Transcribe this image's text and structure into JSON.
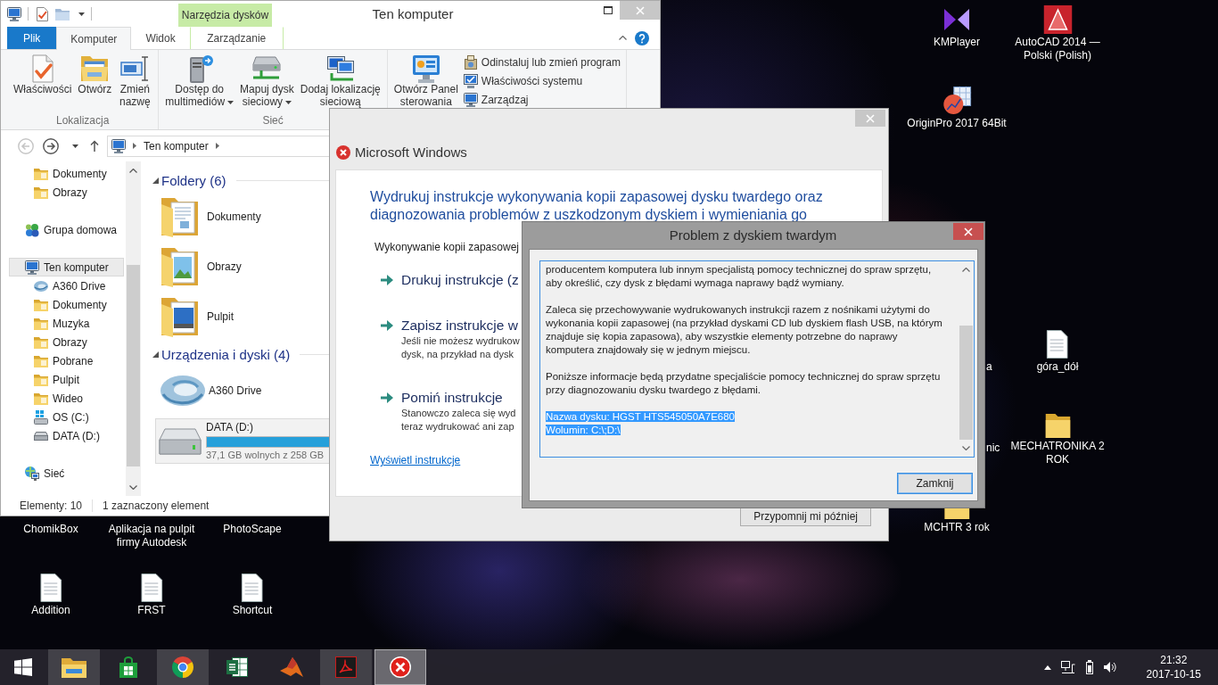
{
  "desktop": {
    "icons": [
      {
        "label": "KMPlayer"
      },
      {
        "label": "AutoCAD 2014 — Polski (Polish)"
      },
      {
        "label": "OriginPro 2017 64Bit"
      },
      {
        "label": "a"
      },
      {
        "label": "góra_dół"
      },
      {
        "label": "nic"
      },
      {
        "label": "MECHATRONIKA 2 ROK"
      },
      {
        "label": "ChomikBox"
      },
      {
        "label": "Aplikacja na pulpit firmy Autodesk"
      },
      {
        "label": "PhotoScape"
      },
      {
        "label": "MCHTR 3 rok"
      },
      {
        "label": "Addition"
      },
      {
        "label": "FRST"
      },
      {
        "label": "Shortcut"
      }
    ]
  },
  "explorer": {
    "title": "Ten komputer",
    "context_tab_group": "Narzędzia dysków",
    "tabs": [
      {
        "label": "Plik",
        "kind": "file",
        "selected": false
      },
      {
        "label": "Komputer",
        "kind": "tab",
        "selected": true
      },
      {
        "label": "Widok",
        "kind": "tab",
        "selected": false
      },
      {
        "label": "Zarządzanie",
        "kind": "contextual",
        "selected": false
      }
    ],
    "ribbon_groups": [
      {
        "label": "Lokalizacja",
        "buttons": [
          {
            "lines": [
              "Właściwości"
            ],
            "kind": "large",
            "dropdown": false
          },
          {
            "lines": [
              "Otwórz"
            ],
            "kind": "large",
            "dropdown": false
          },
          {
            "lines": [
              "Zmień",
              "nazwę"
            ],
            "kind": "large",
            "dropdown": false
          }
        ]
      },
      {
        "label": "Sieć",
        "buttons": [
          {
            "lines": [
              "Dostęp do",
              "multimediów"
            ],
            "kind": "large",
            "dropdown": true
          },
          {
            "lines": [
              "Mapuj dysk",
              "sieciowy"
            ],
            "kind": "large",
            "dropdown": true
          },
          {
            "lines": [
              "Dodaj lokalizację",
              "sieciową"
            ],
            "kind": "large",
            "dropdown": false
          }
        ]
      },
      {
        "buttons": [
          {
            "lines": [
              "Otwórz Panel",
              "sterowania"
            ],
            "kind": "large",
            "dropdown": false
          },
          {
            "lines": [
              "Odinstaluj lub zmień program"
            ],
            "kind": "small",
            "dropdown": false
          },
          {
            "lines": [
              "Właściwości systemu"
            ],
            "kind": "small",
            "dropdown": false
          },
          {
            "lines": [
              "Zarządzaj"
            ],
            "kind": "small",
            "dropdown": false
          }
        ]
      }
    ],
    "address": {
      "crumbs": [
        "Ten komputer"
      ]
    },
    "nav_pane": {
      "items": [
        {
          "children": [
            {
              "label": "Dokumenty",
              "kind": "folder",
              "selected": false
            },
            {
              "label": "Obrazy",
              "kind": "folder",
              "selected": false
            }
          ]
        },
        {
          "label": "Grupa domowa",
          "kind": "homegroup",
          "selected": false
        },
        {
          "label": "Ten komputer",
          "kind": "computer",
          "selected": true,
          "children": [
            {
              "label": "A360 Drive",
              "kind": "cloud",
              "selected": false
            },
            {
              "label": "Dokumenty",
              "kind": "folder",
              "selected": false
            },
            {
              "label": "Muzyka",
              "kind": "folder",
              "selected": false
            },
            {
              "label": "Obrazy",
              "kind": "folder",
              "selected": false
            },
            {
              "label": "Pobrane",
              "kind": "folder",
              "selected": false
            },
            {
              "label": "Pulpit",
              "kind": "folder",
              "selected": false
            },
            {
              "label": "Wideo",
              "kind": "folder",
              "selected": false
            },
            {
              "label": "OS (C:)",
              "kind": "system-drive",
              "selected": false
            },
            {
              "label": "DATA (D:)",
              "kind": "drive",
              "selected": false
            }
          ]
        },
        {
          "label": "Sieć",
          "kind": "network",
          "selected": false
        }
      ]
    },
    "content": {
      "groups": [
        {
          "heading": "Foldery (6)",
          "items": [
            {
              "label": "Dokumenty",
              "kind": "folder",
              "selected": false
            },
            {
              "label": "Obrazy",
              "kind": "folder",
              "selected": false
            },
            {
              "label": "Pulpit",
              "kind": "folder",
              "selected": false
            }
          ]
        },
        {
          "heading": "Urządzenia i dyski (4)",
          "items": [
            {
              "label": "A360 Drive",
              "kind": "cloud",
              "selected": false
            },
            {
              "label": "DATA (D:)",
              "kind": "drive",
              "selected": true,
              "level": 0.86,
              "free_space": "37,1 GB wolnych z 258 GB"
            }
          ]
        }
      ]
    },
    "status_bar": {
      "item_count": "Elementy: 10",
      "selection": "1 zaznaczony element"
    }
  },
  "ms_dialog": {
    "title": "Microsoft Windows",
    "heading": "Wydrukuj instrukcje wykonywania kopii zapasowej dysku twardego oraz diagnozowania problemów z uszkodzonym dyskiem i wymieniania go",
    "intro": "Wykonywanie kopii zapasowej",
    "options": [
      {
        "title": "Drukuj instrukcje (z"
      },
      {
        "title": "Zapisz instrukcje w",
        "description": [
          "Jeśli nie możesz wydrukow",
          "dysk, na przykład na dysk"
        ]
      },
      {
        "title": "Pomiń instrukcje",
        "description": [
          "Stanowczo zaleca się wyd",
          "teraz wydrukować ani zap"
        ]
      }
    ],
    "link": "Wyświetl instrukcje",
    "button": "Przypomnij mi później"
  },
  "problem_dialog": {
    "title": "Problem z dyskiem twardym",
    "details": [
      {
        "lines": [
          "producentem komputera lub innym specjalistą pomocy technicznej do spraw sprzętu,",
          "aby określić, czy dysk z błędami wymaga naprawy bądź wymiany."
        ],
        "selected": false
      },
      {
        "lines": [
          "Zaleca się przechowywanie wydrukowanych instrukcji razem z nośnikami użytymi do",
          "wykonania kopii zapasowej (na przykład dyskami CD lub dyskiem flash USB, na którym",
          "znajduje się kopia zapasowa), aby wszystkie elementy potrzebne do naprawy",
          "komputera znajdowały się w jednym miejscu."
        ],
        "selected": false
      },
      {
        "lines": [
          "Poniższe informacje będą przydatne specjaliście pomocy technicznej do spraw sprzętu",
          "przy diagnozowaniu dysku twardego z błędami."
        ],
        "selected": false
      },
      {
        "lines": [
          "Nazwa dysku: HGST HTS545050A7E680",
          "Wolumin: C:\\;D:\\"
        ],
        "selected": true
      }
    ],
    "button": "Zamknij"
  },
  "taskbar": {
    "apps": [
      {
        "running": true,
        "active": false
      },
      {
        "running": false,
        "active": false
      },
      {
        "running": true,
        "active": false
      },
      {
        "running": false,
        "active": false
      },
      {
        "running": false,
        "active": false
      },
      {
        "running": true,
        "active": false
      },
      {
        "running": true,
        "active": true
      }
    ],
    "clock": {
      "time": "21:32",
      "date": "2017-10-15"
    }
  }
}
